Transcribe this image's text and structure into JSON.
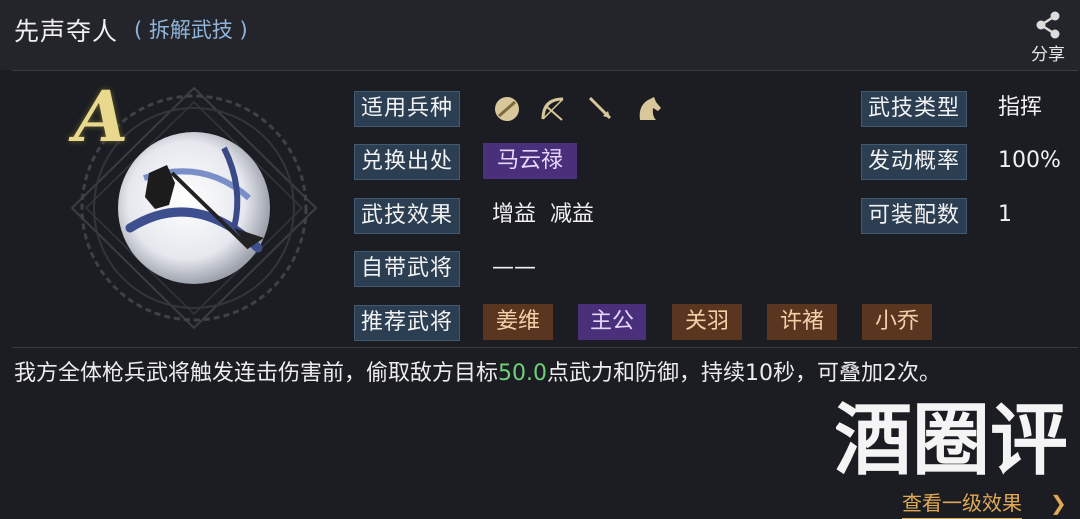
{
  "header": {
    "title": "先声夺人",
    "subtitle": "( 拆解武技 )",
    "share_label": "分享"
  },
  "skill": {
    "grade": "A"
  },
  "rows": {
    "troop_label": "适用兵种",
    "source_label": "兑换出处",
    "source_value": "马云禄",
    "effect_label": "武技效果",
    "effect_value": "增益  减益",
    "own_general_label": "自带武将",
    "own_general_value": "——",
    "recommend_label": "推荐武将",
    "recommend": [
      "姜维",
      "主公",
      "关羽",
      "许褚",
      "小乔"
    ]
  },
  "right": {
    "type_label": "武技类型",
    "type_value": "指挥",
    "chance_label": "发动概率",
    "chance_value": "100%",
    "slots_label": "可装配数",
    "slots_value": "1"
  },
  "troop_icons": [
    "shield-icon",
    "bow-icon",
    "spear-icon",
    "horse-icon"
  ],
  "description": {
    "part1": "我方全体枪兵武将触发连击伤害前，偷取敌方目标",
    "highlight": "50.0",
    "part2": "点武力和防御，持续10秒，可叠加2次。"
  },
  "watermark": {
    "text": "酒圈评"
  },
  "footer": {
    "more_label": "查看一级效果"
  },
  "colors": {
    "label_bg": "#2c3e52",
    "purple_tag": "#4a2f7a",
    "brown_tag": "#5a3620",
    "highlight": "#6fd07a",
    "link": "#e1a957"
  }
}
